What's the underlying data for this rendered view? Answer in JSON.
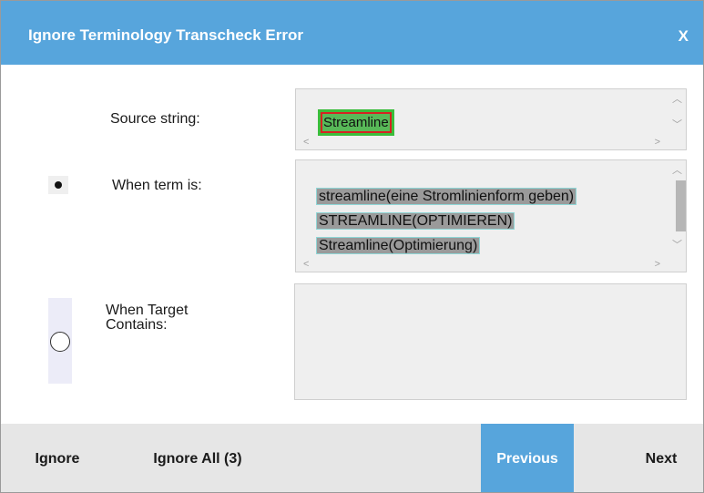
{
  "dialog": {
    "title": "Ignore Terminology Transcheck Error",
    "close_label": "X"
  },
  "fields": {
    "source_label": "Source string:",
    "term_label": "When term is:",
    "target_label": "When Target Contains:"
  },
  "source_value": "Streamline",
  "term_values": [
    "streamline(eine Stromlinienform geben)",
    "STREAMLINE(OPTIMIEREN)",
    "Streamline(Optimierung)"
  ],
  "target_value": "",
  "options": {
    "selected": "when-term-is"
  },
  "footer": {
    "ignore": "Ignore",
    "ignore_all": "Ignore All (3)",
    "previous": "Previous",
    "next": "Next"
  },
  "colors": {
    "accent": "#57a5dc",
    "source_highlight": "#58b958",
    "term_highlight": "#9a9a9a"
  }
}
